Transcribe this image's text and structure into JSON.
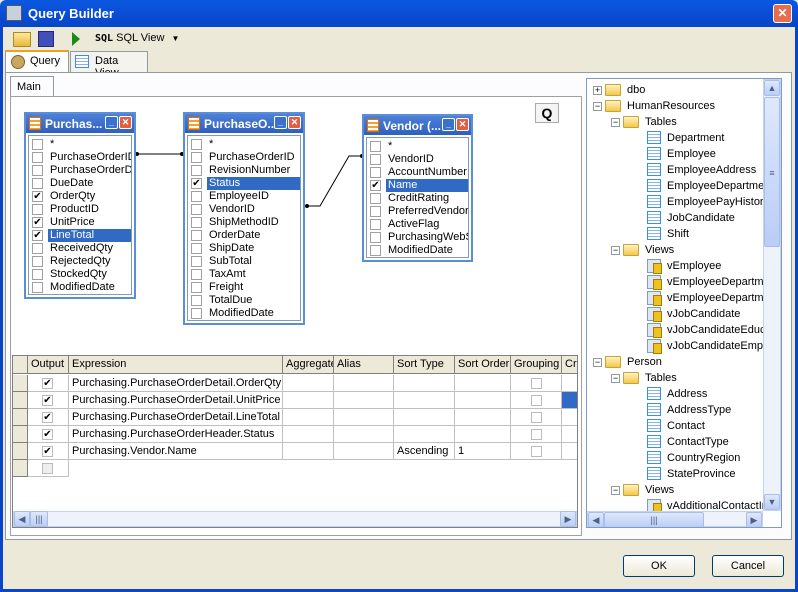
{
  "window": {
    "title": "Query Builder",
    "close_icon": "close-icon"
  },
  "toolbar": {
    "open_icon": "open-folder-icon",
    "save_icon": "save-icon",
    "run_icon": "run-icon",
    "sql_icon_text": "SQL",
    "sql_view_label": "SQL View"
  },
  "tabs": [
    {
      "label": "Query",
      "active": true
    },
    {
      "label": "Data View",
      "active": false
    }
  ],
  "subtabs": [
    {
      "label": "Main"
    }
  ],
  "diagram": {
    "zoom_button": "Q",
    "tables": [
      {
        "title": "Purchas...",
        "fields": [
          [
            "*",
            false
          ],
          [
            "PurchaseOrderID",
            false
          ],
          [
            "PurchaseOrderDe",
            false
          ],
          [
            "DueDate",
            false
          ],
          [
            "OrderQty",
            true
          ],
          [
            "ProductID",
            false
          ],
          [
            "UnitPrice",
            true
          ],
          [
            "LineTotal",
            true
          ],
          [
            "ReceivedQty",
            false
          ],
          [
            "RejectedQty",
            false
          ],
          [
            "StockedQty",
            false
          ],
          [
            "ModifiedDate",
            false
          ]
        ],
        "selected": "LineTotal"
      },
      {
        "title": "PurchaseO...",
        "fields": [
          [
            "*",
            false
          ],
          [
            "PurchaseOrderID",
            false
          ],
          [
            "RevisionNumber",
            false
          ],
          [
            "Status",
            true
          ],
          [
            "EmployeeID",
            false
          ],
          [
            "VendorID",
            false
          ],
          [
            "ShipMethodID",
            false
          ],
          [
            "OrderDate",
            false
          ],
          [
            "ShipDate",
            false
          ],
          [
            "SubTotal",
            false
          ],
          [
            "TaxAmt",
            false
          ],
          [
            "Freight",
            false
          ],
          [
            "TotalDue",
            false
          ],
          [
            "ModifiedDate",
            false
          ]
        ],
        "selected": "Status"
      },
      {
        "title": "Vendor (...",
        "fields": [
          [
            "*",
            false
          ],
          [
            "VendorID",
            false
          ],
          [
            "AccountNumber",
            false
          ],
          [
            "Name",
            true
          ],
          [
            "CreditRating",
            false
          ],
          [
            "PreferredVendorS",
            false
          ],
          [
            "ActiveFlag",
            false
          ],
          [
            "PurchasingWebS",
            false
          ],
          [
            "ModifiedDate",
            false
          ]
        ],
        "selected": "Name"
      }
    ]
  },
  "grid": {
    "columns": [
      "Output",
      "Expression",
      "Aggregate",
      "Alias",
      "Sort Type",
      "Sort Order",
      "Grouping",
      "Cri"
    ],
    "rows": [
      {
        "output": true,
        "expression": "Purchasing.PurchaseOrderDetail.OrderQty",
        "aggregate": "",
        "alias": "",
        "sort_type": "",
        "sort_order": "",
        "grouping": false
      },
      {
        "output": true,
        "expression": "Purchasing.PurchaseOrderDetail.UnitPrice",
        "aggregate": "",
        "alias": "",
        "sort_type": "",
        "sort_order": "",
        "grouping": false
      },
      {
        "output": true,
        "expression": "Purchasing.PurchaseOrderDetail.LineTotal",
        "aggregate": "",
        "alias": "",
        "sort_type": "",
        "sort_order": "",
        "grouping": false
      },
      {
        "output": true,
        "expression": "Purchasing.PurchaseOrderHeader.Status",
        "aggregate": "",
        "alias": "",
        "sort_type": "",
        "sort_order": "",
        "grouping": false
      },
      {
        "output": true,
        "expression": "Purchasing.Vendor.Name",
        "aggregate": "",
        "alias": "",
        "sort_type": "Ascending",
        "sort_order": "1",
        "grouping": false
      }
    ]
  },
  "tree": [
    {
      "level": 0,
      "label": "dbo",
      "kind": "folder",
      "expander": "+"
    },
    {
      "level": 0,
      "label": "HumanResources",
      "kind": "folder",
      "expander": "-"
    },
    {
      "level": 1,
      "label": "Tables",
      "kind": "folder",
      "expander": "-"
    },
    {
      "level": 2,
      "label": "Department",
      "kind": "table"
    },
    {
      "level": 2,
      "label": "Employee",
      "kind": "table"
    },
    {
      "level": 2,
      "label": "EmployeeAddress",
      "kind": "table"
    },
    {
      "level": 2,
      "label": "EmployeeDepartmen",
      "kind": "table"
    },
    {
      "level": 2,
      "label": "EmployeePayHistory",
      "kind": "table"
    },
    {
      "level": 2,
      "label": "JobCandidate",
      "kind": "table"
    },
    {
      "level": 2,
      "label": "Shift",
      "kind": "table"
    },
    {
      "level": 1,
      "label": "Views",
      "kind": "folder",
      "expander": "-"
    },
    {
      "level": 2,
      "label": "vEmployee",
      "kind": "view"
    },
    {
      "level": 2,
      "label": "vEmployeeDepartme",
      "kind": "view"
    },
    {
      "level": 2,
      "label": "vEmployeeDepartme",
      "kind": "view"
    },
    {
      "level": 2,
      "label": "vJobCandidate",
      "kind": "view"
    },
    {
      "level": 2,
      "label": "vJobCandidateEduc",
      "kind": "view"
    },
    {
      "level": 2,
      "label": "vJobCandidateEmplo",
      "kind": "view"
    },
    {
      "level": 0,
      "label": "Person",
      "kind": "folder",
      "expander": "-"
    },
    {
      "level": 1,
      "label": "Tables",
      "kind": "folder",
      "expander": "-"
    },
    {
      "level": 2,
      "label": "Address",
      "kind": "table"
    },
    {
      "level": 2,
      "label": "AddressType",
      "kind": "table"
    },
    {
      "level": 2,
      "label": "Contact",
      "kind": "table"
    },
    {
      "level": 2,
      "label": "ContactType",
      "kind": "table"
    },
    {
      "level": 2,
      "label": "CountryRegion",
      "kind": "table"
    },
    {
      "level": 2,
      "label": "StateProvince",
      "kind": "table"
    },
    {
      "level": 1,
      "label": "Views",
      "kind": "folder",
      "expander": "-"
    },
    {
      "level": 2,
      "label": "vAdditionalContactIn",
      "kind": "view"
    }
  ],
  "buttons": {
    "ok": "OK",
    "cancel": "Cancel"
  },
  "colors": {
    "title_bar": "#0a5ae0",
    "selection": "#316ac5",
    "table_header": "#2e5fbf"
  }
}
